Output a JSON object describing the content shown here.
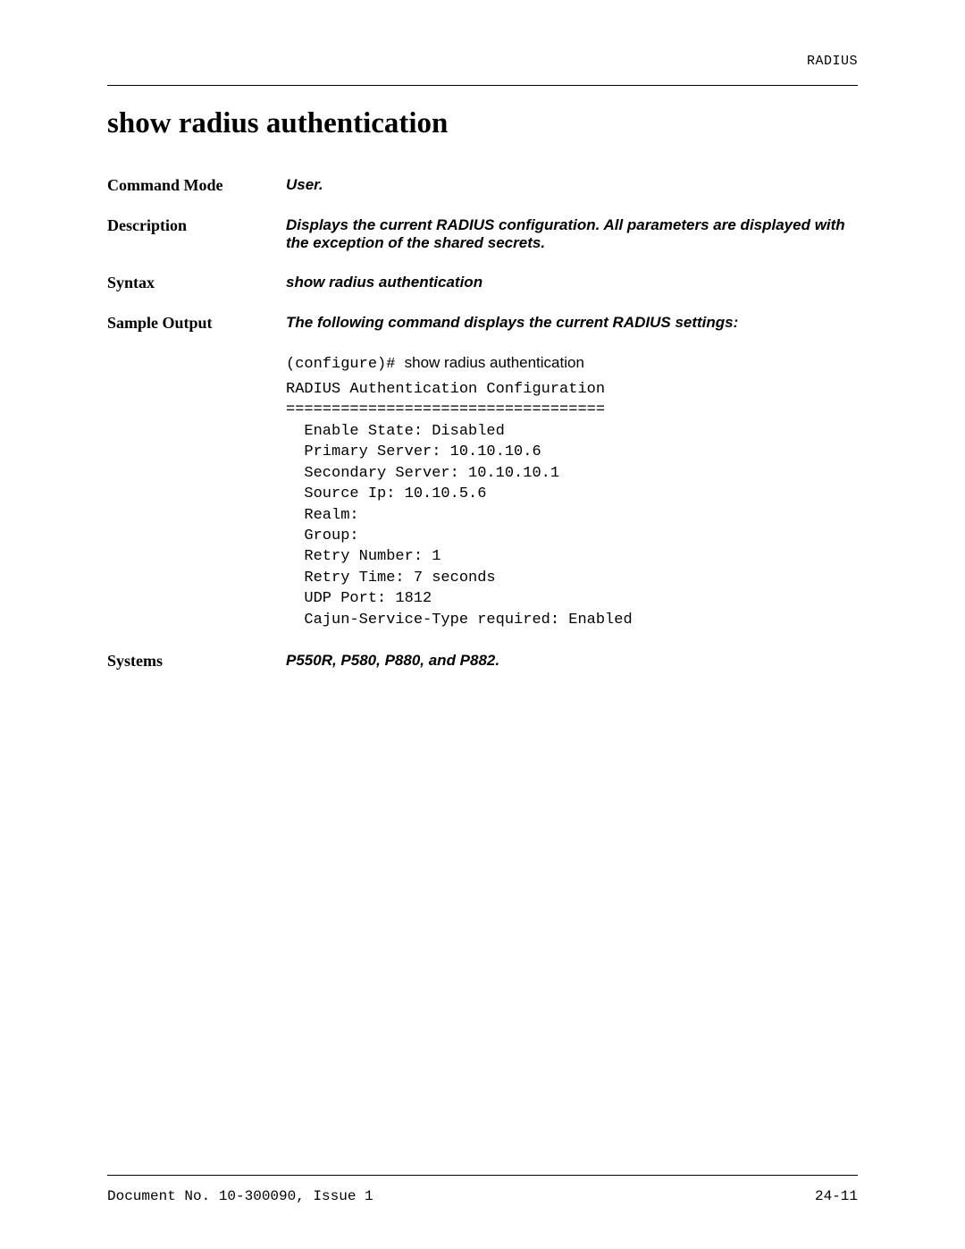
{
  "header": {
    "section": "RADIUS"
  },
  "title": "show radius authentication",
  "rows": {
    "command_mode": {
      "label": "Command Mode",
      "value": "User."
    },
    "description": {
      "label": "Description",
      "value": "Displays the current RADIUS configuration. All parameters are displayed with the exception of the shared secrets."
    },
    "syntax": {
      "label": "Syntax",
      "value": "show radius authentication"
    },
    "sample_output": {
      "label": "Sample Output",
      "intro": "The following command displays the current RADIUS settings:",
      "prompt": "(configure)# ",
      "command": "show radius authentication",
      "output": "RADIUS Authentication Configuration\n===================================\n  Enable State: Disabled\n  Primary Server: 10.10.10.6\n  Secondary Server: 10.10.10.1\n  Source Ip: 10.10.5.6\n  Realm:\n  Group:\n  Retry Number: 1\n  Retry Time: 7 seconds\n  UDP Port: 1812\n  Cajun-Service-Type required: Enabled"
    },
    "systems": {
      "label": "Systems",
      "value": "P550R, P580, P880, and P882."
    }
  },
  "footer": {
    "doc": "Document No. 10-300090, Issue 1",
    "page": "24-11"
  }
}
